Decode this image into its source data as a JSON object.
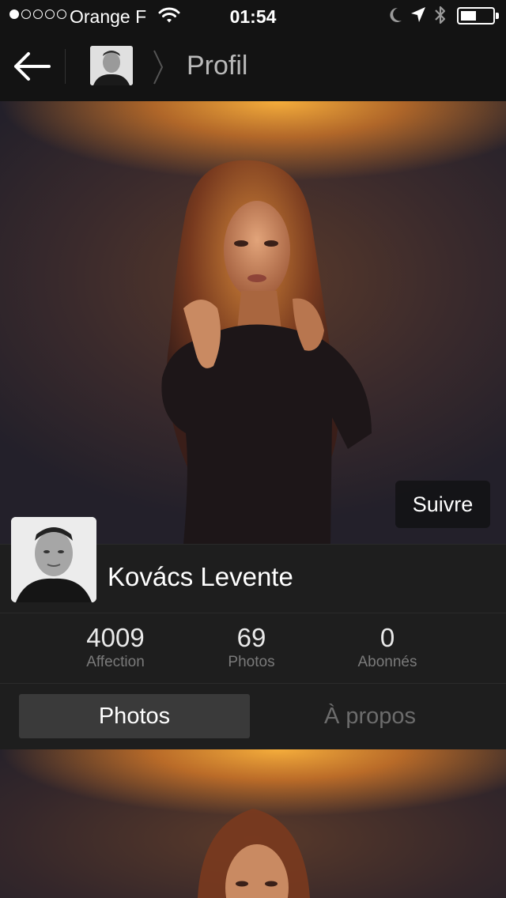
{
  "status_bar": {
    "signal_bars_filled": 1,
    "signal_bars_total": 5,
    "carrier": "Orange F",
    "time": "01:54",
    "battery_level": 0.5,
    "icons": [
      "wifi-icon",
      "moon-icon",
      "location-arrow-icon",
      "bluetooth-icon",
      "battery-icon"
    ]
  },
  "nav": {
    "title": "Profil",
    "back_icon": "arrow-left-icon",
    "separator_icon": "chevron-right-icon"
  },
  "hero": {
    "follow_label": "Suivre"
  },
  "profile": {
    "name": "Kovács Levente"
  },
  "stats": [
    {
      "value": "4009",
      "label": "Affection"
    },
    {
      "value": "69",
      "label": "Photos"
    },
    {
      "value": "0",
      "label": "Abonnés"
    }
  ],
  "tabs": [
    {
      "label": "Photos",
      "active": true
    },
    {
      "label": "À propos",
      "active": false
    }
  ],
  "colors": {
    "background": "#111111",
    "panel": "#1e1e1e",
    "active_tab": "#3a3a3a",
    "muted_text": "#7a7a7a",
    "accent_glow": "#ffb43c"
  }
}
